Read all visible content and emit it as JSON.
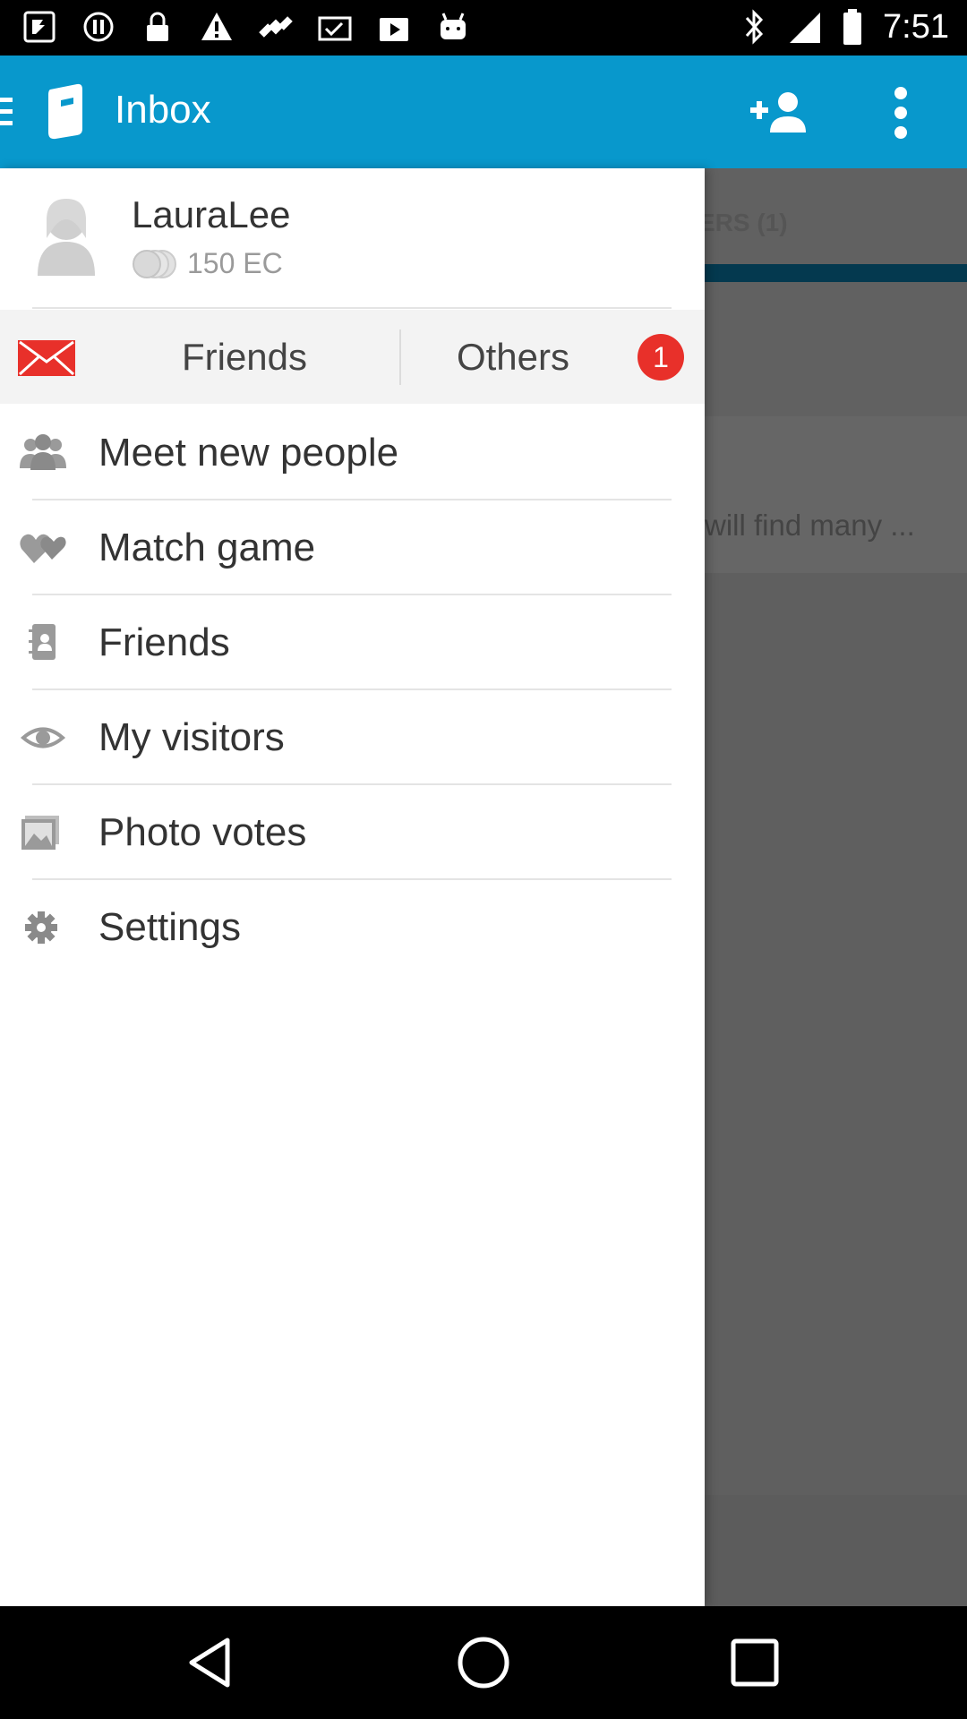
{
  "status_bar": {
    "time": "7:51",
    "left_icons": [
      "notification-icon",
      "notification-icon",
      "lock-icon",
      "warning-icon",
      "satellite-icon",
      "mail-check-icon",
      "play-store-icon",
      "android-icon"
    ],
    "right_icons": [
      "bluetooth-icon",
      "signal-icon",
      "battery-icon"
    ]
  },
  "app_bar": {
    "title": "Inbox",
    "color": "#0898cc"
  },
  "background_content": {
    "tab_text": "ERS (1)",
    "message_preview": "will find many ..."
  },
  "drawer": {
    "profile": {
      "name": "LauraLee",
      "coins": "150 EC"
    },
    "message_tabs": {
      "friends_label": "Friends",
      "others_label": "Others",
      "others_badge": "1"
    },
    "menu": [
      {
        "label": "Meet new people",
        "icon": "people-icon"
      },
      {
        "label": "Match game",
        "icon": "hearts-icon"
      },
      {
        "label": "Friends",
        "icon": "contacts-icon"
      },
      {
        "label": "My visitors",
        "icon": "eye-icon"
      },
      {
        "label": "Photo votes",
        "icon": "photos-icon"
      },
      {
        "label": "Settings",
        "icon": "gear-icon"
      }
    ]
  },
  "colors": {
    "accent": "#0898cc",
    "badge": "#e8302a",
    "mail_icon": "#e8302a"
  }
}
